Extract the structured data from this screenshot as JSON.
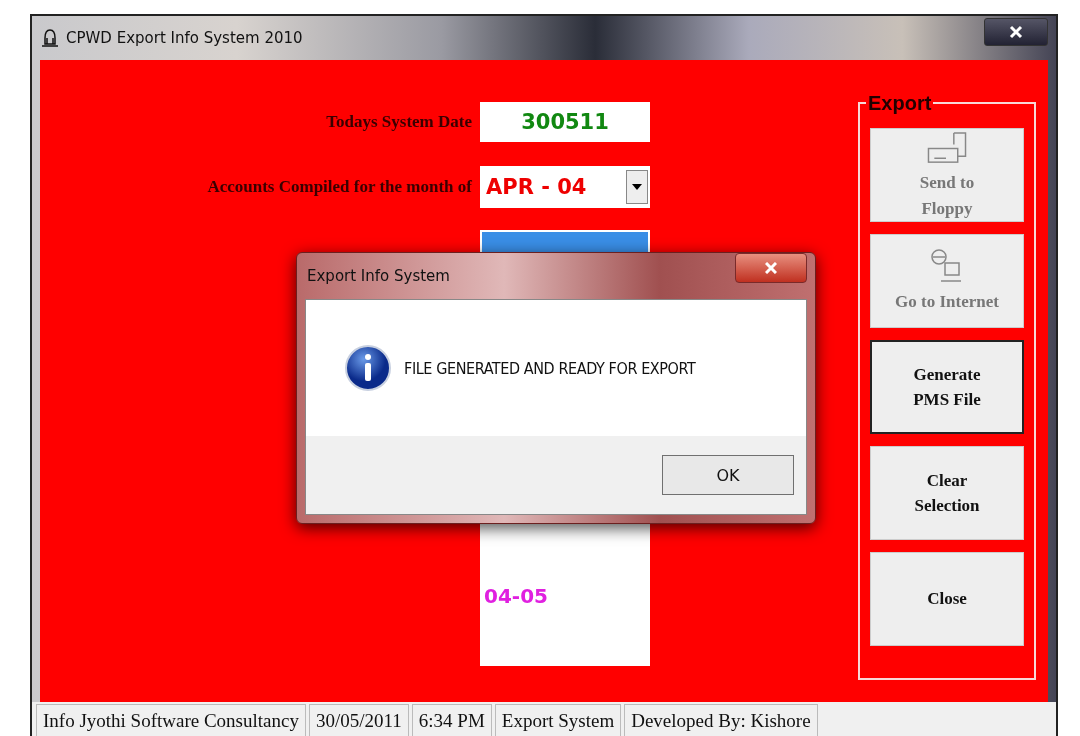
{
  "window": {
    "title": "CPWD Export Info System 2010"
  },
  "form": {
    "date_label": "Todays System Date",
    "date_value": "300511",
    "month_label": "Accounts Compiled for the month of",
    "month_value": "APR - 04"
  },
  "list": {
    "highlighted": true,
    "items": [
      {
        "label": "04-05",
        "selected": false
      }
    ]
  },
  "export_group": {
    "title": "Export",
    "buttons": [
      {
        "label": "Send to Floppy",
        "kind": "floppy",
        "disabled": true,
        "focused": false
      },
      {
        "label": "Go to Internet",
        "kind": "internet",
        "disabled": true,
        "focused": false
      },
      {
        "label": "Generate PMS File",
        "kind": "text",
        "disabled": false,
        "focused": true
      },
      {
        "label": "Clear Selection",
        "kind": "text",
        "disabled": false,
        "focused": false
      },
      {
        "label": "Close",
        "kind": "text",
        "disabled": false,
        "focused": false
      }
    ]
  },
  "status_bar": [
    "Info Jyothi Software Consultancy",
    "30/05/2011",
    "6:34 PM",
    "Export System",
    "Developed By: Kishore"
  ],
  "dialog": {
    "title": "Export Info System",
    "message": "FILE GENERATED AND READY FOR EXPORT",
    "button": "OK"
  }
}
